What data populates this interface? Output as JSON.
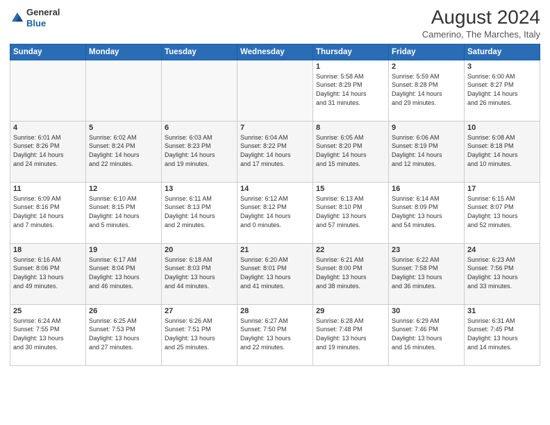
{
  "header": {
    "logo_line1": "General",
    "logo_line2": "Blue",
    "month_year": "August 2024",
    "location": "Camerino, The Marches, Italy"
  },
  "weekdays": [
    "Sunday",
    "Monday",
    "Tuesday",
    "Wednesday",
    "Thursday",
    "Friday",
    "Saturday"
  ],
  "weeks": [
    [
      {
        "day": "",
        "info": ""
      },
      {
        "day": "",
        "info": ""
      },
      {
        "day": "",
        "info": ""
      },
      {
        "day": "",
        "info": ""
      },
      {
        "day": "1",
        "info": "Sunrise: 5:58 AM\nSunset: 8:29 PM\nDaylight: 14 hours\nand 31 minutes."
      },
      {
        "day": "2",
        "info": "Sunrise: 5:59 AM\nSunset: 8:28 PM\nDaylight: 14 hours\nand 29 minutes."
      },
      {
        "day": "3",
        "info": "Sunrise: 6:00 AM\nSunset: 8:27 PM\nDaylight: 14 hours\nand 26 minutes."
      }
    ],
    [
      {
        "day": "4",
        "info": "Sunrise: 6:01 AM\nSunset: 8:26 PM\nDaylight: 14 hours\nand 24 minutes."
      },
      {
        "day": "5",
        "info": "Sunrise: 6:02 AM\nSunset: 8:24 PM\nDaylight: 14 hours\nand 22 minutes."
      },
      {
        "day": "6",
        "info": "Sunrise: 6:03 AM\nSunset: 8:23 PM\nDaylight: 14 hours\nand 19 minutes."
      },
      {
        "day": "7",
        "info": "Sunrise: 6:04 AM\nSunset: 8:22 PM\nDaylight: 14 hours\nand 17 minutes."
      },
      {
        "day": "8",
        "info": "Sunrise: 6:05 AM\nSunset: 8:20 PM\nDaylight: 14 hours\nand 15 minutes."
      },
      {
        "day": "9",
        "info": "Sunrise: 6:06 AM\nSunset: 8:19 PM\nDaylight: 14 hours\nand 12 minutes."
      },
      {
        "day": "10",
        "info": "Sunrise: 6:08 AM\nSunset: 8:18 PM\nDaylight: 14 hours\nand 10 minutes."
      }
    ],
    [
      {
        "day": "11",
        "info": "Sunrise: 6:09 AM\nSunset: 8:16 PM\nDaylight: 14 hours\nand 7 minutes."
      },
      {
        "day": "12",
        "info": "Sunrise: 6:10 AM\nSunset: 8:15 PM\nDaylight: 14 hours\nand 5 minutes."
      },
      {
        "day": "13",
        "info": "Sunrise: 6:11 AM\nSunset: 8:13 PM\nDaylight: 14 hours\nand 2 minutes."
      },
      {
        "day": "14",
        "info": "Sunrise: 6:12 AM\nSunset: 8:12 PM\nDaylight: 14 hours\nand 0 minutes."
      },
      {
        "day": "15",
        "info": "Sunrise: 6:13 AM\nSunset: 8:10 PM\nDaylight: 13 hours\nand 57 minutes."
      },
      {
        "day": "16",
        "info": "Sunrise: 6:14 AM\nSunset: 8:09 PM\nDaylight: 13 hours\nand 54 minutes."
      },
      {
        "day": "17",
        "info": "Sunrise: 6:15 AM\nSunset: 8:07 PM\nDaylight: 13 hours\nand 52 minutes."
      }
    ],
    [
      {
        "day": "18",
        "info": "Sunrise: 6:16 AM\nSunset: 8:06 PM\nDaylight: 13 hours\nand 49 minutes."
      },
      {
        "day": "19",
        "info": "Sunrise: 6:17 AM\nSunset: 8:04 PM\nDaylight: 13 hours\nand 46 minutes."
      },
      {
        "day": "20",
        "info": "Sunrise: 6:18 AM\nSunset: 8:03 PM\nDaylight: 13 hours\nand 44 minutes."
      },
      {
        "day": "21",
        "info": "Sunrise: 6:20 AM\nSunset: 8:01 PM\nDaylight: 13 hours\nand 41 minutes."
      },
      {
        "day": "22",
        "info": "Sunrise: 6:21 AM\nSunset: 8:00 PM\nDaylight: 13 hours\nand 38 minutes."
      },
      {
        "day": "23",
        "info": "Sunrise: 6:22 AM\nSunset: 7:58 PM\nDaylight: 13 hours\nand 36 minutes."
      },
      {
        "day": "24",
        "info": "Sunrise: 6:23 AM\nSunset: 7:56 PM\nDaylight: 13 hours\nand 33 minutes."
      }
    ],
    [
      {
        "day": "25",
        "info": "Sunrise: 6:24 AM\nSunset: 7:55 PM\nDaylight: 13 hours\nand 30 minutes."
      },
      {
        "day": "26",
        "info": "Sunrise: 6:25 AM\nSunset: 7:53 PM\nDaylight: 13 hours\nand 27 minutes."
      },
      {
        "day": "27",
        "info": "Sunrise: 6:26 AM\nSunset: 7:51 PM\nDaylight: 13 hours\nand 25 minutes."
      },
      {
        "day": "28",
        "info": "Sunrise: 6:27 AM\nSunset: 7:50 PM\nDaylight: 13 hours\nand 22 minutes."
      },
      {
        "day": "29",
        "info": "Sunrise: 6:28 AM\nSunset: 7:48 PM\nDaylight: 13 hours\nand 19 minutes."
      },
      {
        "day": "30",
        "info": "Sunrise: 6:29 AM\nSunset: 7:46 PM\nDaylight: 13 hours\nand 16 minutes."
      },
      {
        "day": "31",
        "info": "Sunrise: 6:31 AM\nSunset: 7:45 PM\nDaylight: 13 hours\nand 14 minutes."
      }
    ]
  ]
}
